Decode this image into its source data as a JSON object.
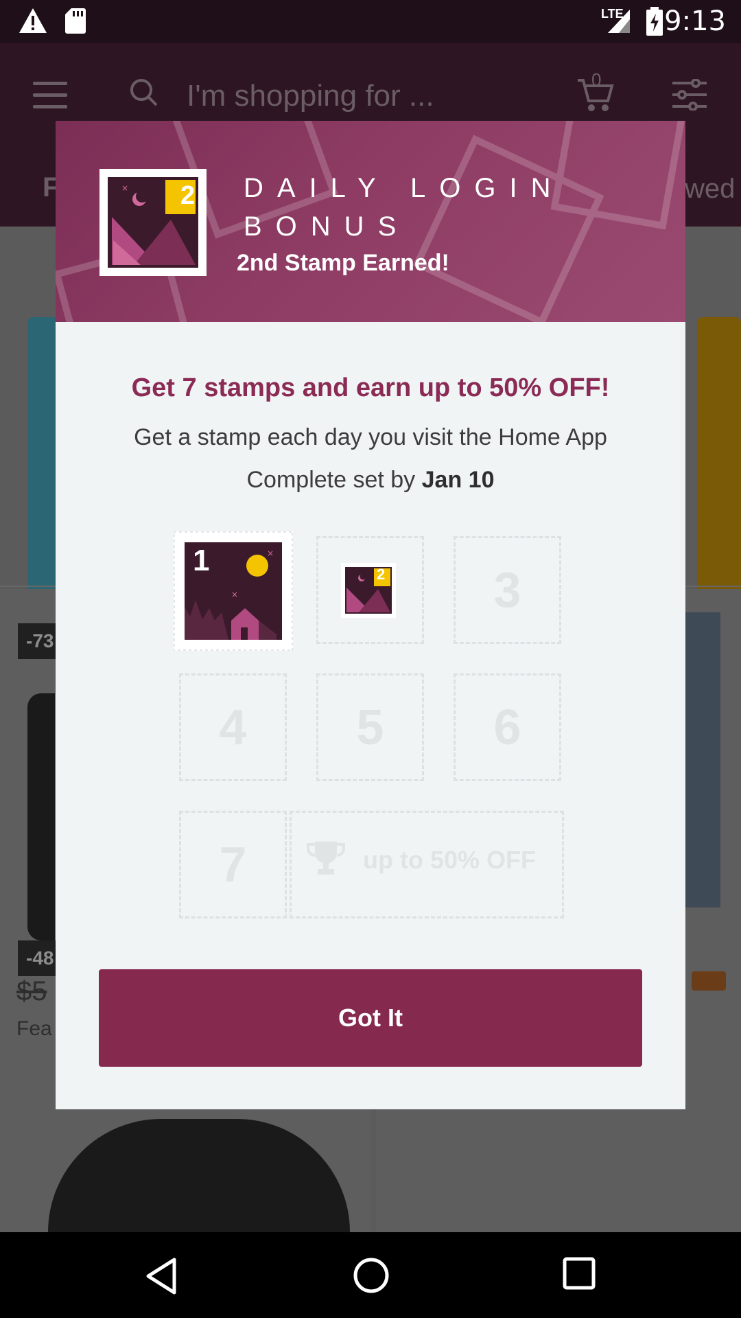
{
  "status_bar": {
    "time": "9:13",
    "network": "LTE",
    "icons": [
      "warning-icon",
      "sd-card-icon",
      "signal-icon",
      "battery-charging-icon"
    ]
  },
  "header": {
    "search_placeholder": "I'm shopping for ...",
    "cart_count": "0",
    "tab_left_fragment": "F",
    "tab_right_fragment": "wed"
  },
  "background": {
    "badge_1": "-73",
    "badge_2": "-48",
    "price": "$5",
    "sub_label": "Fea"
  },
  "dialog": {
    "title": "DAILY LOGIN BONUS",
    "subtitle": "2nd Stamp Earned!",
    "big_stamp_number": "2",
    "headline": "Get 7 stamps and earn up to 50% OFF!",
    "description": "Get a stamp each day you visit the Home App",
    "deadline_prefix": "Complete set by",
    "deadline_date": "Jan 10",
    "stamp1_number": "1",
    "stamp2_number": "2",
    "slots": [
      "3",
      "4",
      "5",
      "6",
      "7"
    ],
    "reward_label": "up to 50% OFF",
    "button_label": "Got It",
    "colors": {
      "accent": "#85294f",
      "header": "#8e3c64",
      "stamp_yellow": "#f5c400"
    }
  },
  "nav_bar": {
    "buttons": [
      "back-icon",
      "home-icon",
      "recents-icon"
    ]
  }
}
